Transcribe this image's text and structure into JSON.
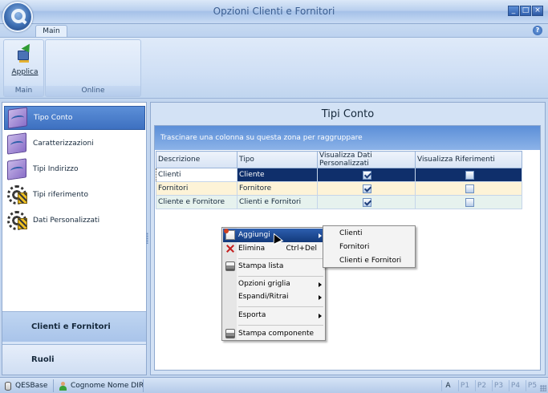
{
  "window": {
    "title": "Opzioni Clienti e Fornitori",
    "controls": [
      "_",
      "□",
      "×"
    ]
  },
  "ribbon": {
    "tabs": [
      "Main"
    ],
    "groups": {
      "main": "Main",
      "online": "Online"
    },
    "applica_label": "Applica",
    "help": "?"
  },
  "nav": {
    "items": [
      {
        "label": "Tipo Conto",
        "icon": "chart-icon",
        "selected": true
      },
      {
        "label": "Caratterizzazioni",
        "icon": "chart-icon"
      },
      {
        "label": "Tipi Indirizzo",
        "icon": "chart-icon"
      },
      {
        "label": "Tipi riferimento",
        "icon": "gear-icon"
      },
      {
        "label": "Dati Personalizzati",
        "icon": "gear-icon"
      }
    ],
    "sections": [
      {
        "label": "Clienti e Fornitori",
        "selected": true
      },
      {
        "label": "Ruoli"
      }
    ]
  },
  "content": {
    "title": "Tipi Conto",
    "group_zone": "Trascinare una colonna su questa zona per raggruppare",
    "columns": [
      "Descrizione",
      "Tipo",
      "Visualizza Dati Personalizzati",
      "Visualizza Riferimenti"
    ],
    "rows": [
      {
        "descrizione": "Clienti",
        "tipo": "Cliente",
        "dati_personalizzati": true,
        "riferimenti": false
      },
      {
        "descrizione": "Fornitori",
        "tipo": "Fornitore",
        "dati_personalizzati": true,
        "riferimenti": false
      },
      {
        "descrizione": "Cliente e Fornitore",
        "tipo": "Clienti e Fornitori",
        "dati_personalizzati": true,
        "riferimenti": false
      }
    ]
  },
  "context_menu": {
    "items": {
      "aggiungi": "Aggiungi",
      "elimina": "Elimina",
      "elimina_shortcut": "Ctrl+Del",
      "stampa_lista": "Stampa lista",
      "opzioni_griglia": "Opzioni griglia",
      "espandi": "Espandi/Ritrai",
      "esporta": "Esporta",
      "stampa_componente": "Stampa componente"
    },
    "submenu": [
      "Clienti",
      "Fornitori",
      "Clienti e Fornitori"
    ]
  },
  "status": {
    "database": "QESBase",
    "user": "Cognome Nome DIR",
    "indicators": [
      "A",
      "P1",
      "P2",
      "P3",
      "P4",
      "P5"
    ]
  },
  "colors": {
    "accent": "#3d70c0",
    "selection": "#0f2f6b",
    "frame": "#c3d6ef"
  }
}
